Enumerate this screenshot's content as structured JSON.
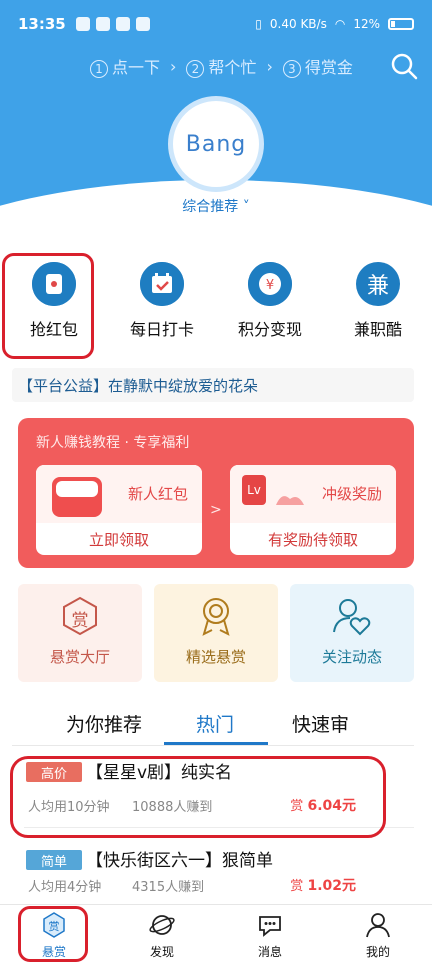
{
  "status_bar": {
    "time": "13:35",
    "network": "0.40 KB/s",
    "battery": "12%"
  },
  "steps": [
    {
      "num": "1",
      "label": "点一下"
    },
    {
      "num": "2",
      "label": "帮个忙"
    },
    {
      "num": "3",
      "label": "得赏金"
    }
  ],
  "logo": {
    "text": "Bang",
    "subtitle": "综合推荐"
  },
  "quick_actions": [
    {
      "label": "抢红包",
      "icon": "red-packet-icon"
    },
    {
      "label": "每日打卡",
      "icon": "calendar-check-icon"
    },
    {
      "label": "积分变现",
      "icon": "points-exchange-icon"
    },
    {
      "label": "兼职酷",
      "icon": "part-time-icon",
      "icon_text": "兼"
    }
  ],
  "notice": {
    "text": "【平台公益】在静默中绽放爱的花朵"
  },
  "promo": {
    "title": "新人赚钱教程 · 专享福利",
    "left_card": {
      "title": "新人红包",
      "button": "立即领取"
    },
    "right_card": {
      "title": "冲级奖励",
      "button": "有奖励待领取",
      "badge": "Lv"
    },
    "separator": ">"
  },
  "features": [
    {
      "label": "悬赏大厅",
      "icon_text": "赏",
      "bg": "#fdf0ec",
      "color": "#c4574a"
    },
    {
      "label": "精选悬赏",
      "icon": "medal-icon",
      "bg": "#fdf3e0",
      "color": "#9a6d1b"
    },
    {
      "label": "关注动态",
      "icon": "user-heart-icon",
      "bg": "#e8f4fb",
      "color": "#1d7a98"
    }
  ],
  "tabs": [
    {
      "label": "为你推荐",
      "active": false
    },
    {
      "label": "热门",
      "active": true
    },
    {
      "label": "快速审",
      "active": false
    }
  ],
  "tasks": [
    {
      "tag": "高价",
      "tag_color": "#e86e60",
      "title": "【星星v剧】纯实名",
      "avg_time": "人均用10分钟",
      "earned": "10888人赚到",
      "reward_prefix": "赏",
      "reward": "6.04元"
    },
    {
      "tag": "简单",
      "tag_color": "#55a6d8",
      "title": "【快乐街区六一】狠简单",
      "avg_time": "人均用4分钟",
      "earned": "4315人赚到",
      "reward_prefix": "赏",
      "reward": "1.02元"
    }
  ],
  "bottom_nav": [
    {
      "label": "悬赏",
      "icon": "reward-icon",
      "icon_text": "赏",
      "active": true
    },
    {
      "label": "发现",
      "icon": "planet-icon",
      "active": false
    },
    {
      "label": "消息",
      "icon": "message-icon",
      "active": false
    },
    {
      "label": "我的",
      "icon": "user-icon",
      "active": false
    }
  ],
  "colors": {
    "primary": "#3fa2e8",
    "accent": "#1f78c8",
    "promo": "#f15c5c",
    "highlight": "#d9202c"
  }
}
